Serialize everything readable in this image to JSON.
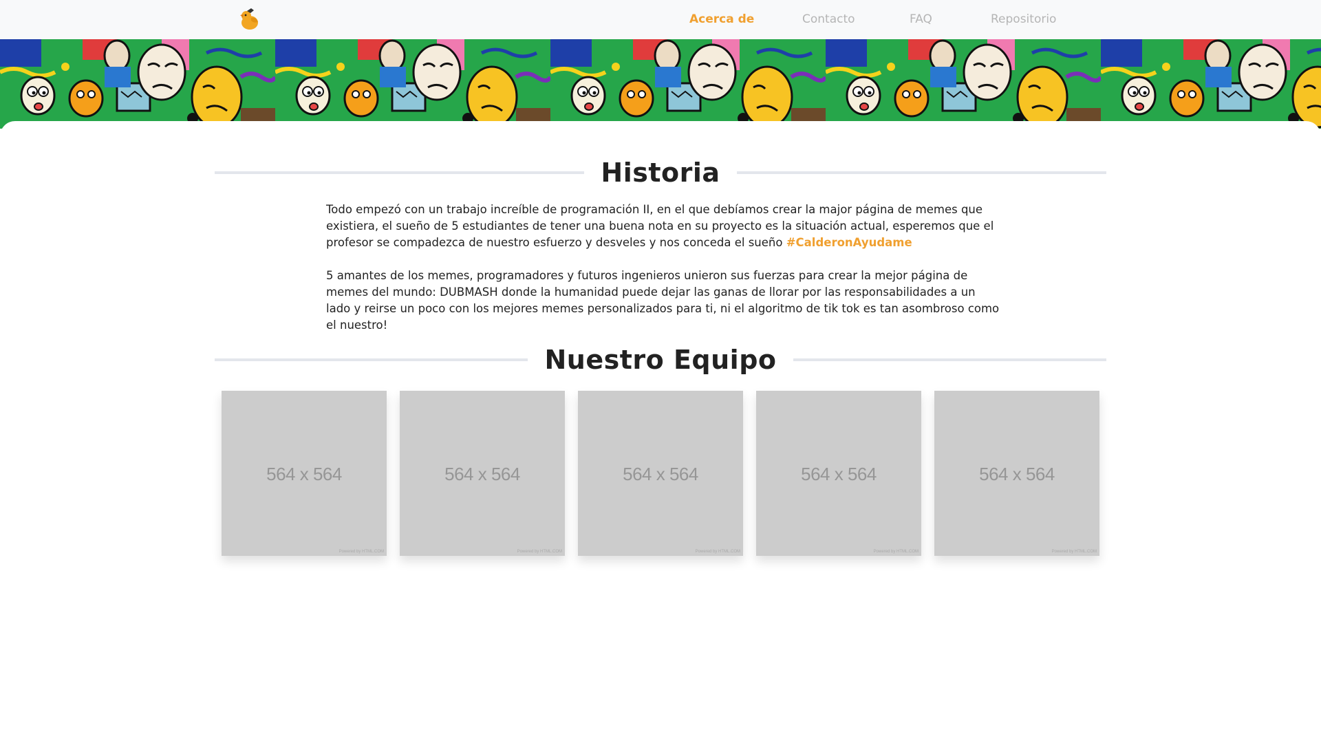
{
  "navbar": {
    "logo_icon": "duck-logo-icon",
    "items": [
      {
        "label": "Acerca de",
        "active": true
      },
      {
        "label": "Contacto",
        "active": false
      },
      {
        "label": "FAQ",
        "active": false
      },
      {
        "label": "Repositorio",
        "active": false
      }
    ]
  },
  "banner": {
    "icon": "meme-collage-banner"
  },
  "historia": {
    "title": "Historia",
    "paragraph1": "Todo empezó con un trabajo increíble de programación II, en el que debíamos crear la major página de memes que existiera, el sueño de 5 estudiantes de tener una buena nota en su proyecto es la situación actual, esperemos que el profesor se compadezca de nuestro esfuerzo y desveles y nos conceda el sueño",
    "hashtag": "#CalderonAyudame",
    "paragraph2": "5 amantes de los memes, programadores y futuros ingenieros unieron sus fuerzas para crear la mejor página de memes del mundo: DUBMASH donde la humanidad puede dejar las ganas de llorar por las responsabilidades a un lado y reirse un poco con los mejores memes personalizados para ti, ni el algoritmo de tik tok es tan asombroso como el nuestro!"
  },
  "equipo": {
    "title": "Nuestro Equipo",
    "members": [
      {
        "placeholder": "564 x 564",
        "powered": "Powered by HTML.COM"
      },
      {
        "placeholder": "564 x 564",
        "powered": "Powered by HTML.COM"
      },
      {
        "placeholder": "564 x 564",
        "powered": "Powered by HTML.COM"
      },
      {
        "placeholder": "564 x 564",
        "powered": "Powered by HTML.COM"
      },
      {
        "placeholder": "564 x 564",
        "powered": "Powered by HTML.COM"
      }
    ]
  },
  "colors": {
    "accent": "#f0a030",
    "navbar_bg": "#f8f9fa",
    "nav_inactive": "#b5b5b5",
    "placeholder_bg": "#cccccc",
    "divider": "#e3e6ec"
  }
}
